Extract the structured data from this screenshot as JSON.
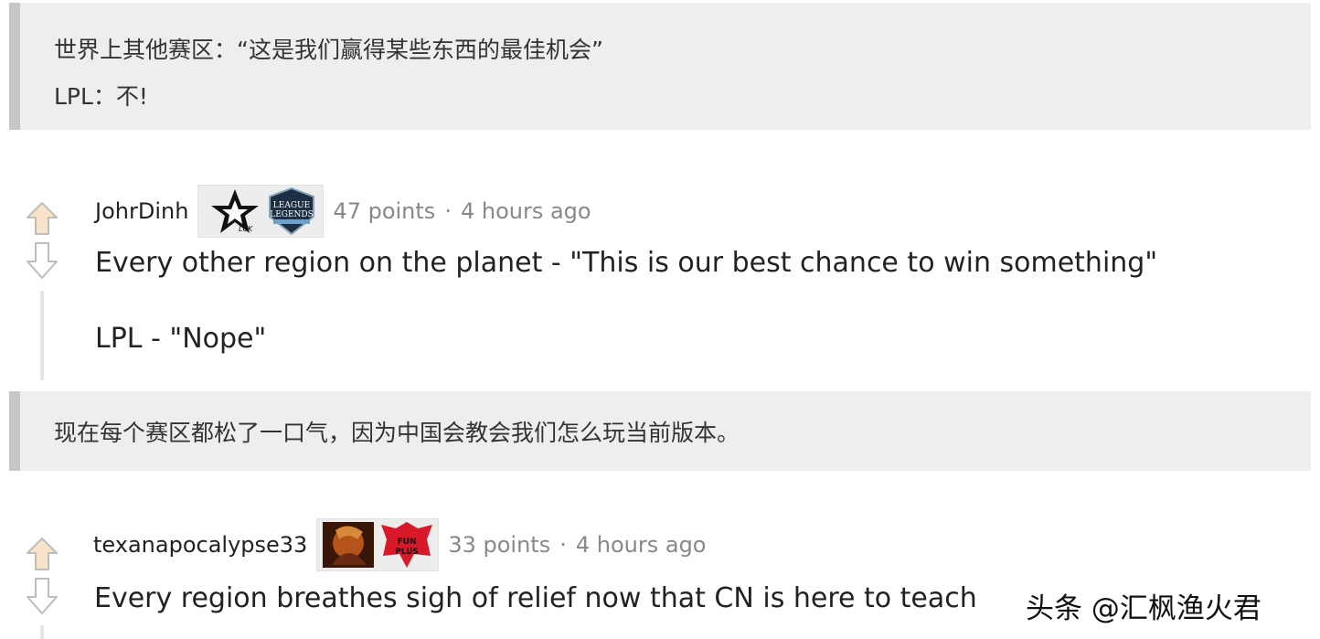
{
  "translation_1": {
    "line_1": "世界上其他赛区：“这是我们赢得某些东西的最佳机会”",
    "line_2": "LPL：不!"
  },
  "comment_1": {
    "username": "JohrDinh",
    "flair_icons": [
      "lck-star-logo-icon",
      "league-of-legends-championship-logo-icon"
    ],
    "points": "47 points",
    "separator": "·",
    "time": "4 hours ago",
    "paragraph_1": "Every other region on the planet - \"This is our best chance to win something\"",
    "paragraph_2": "LPL - \"Nope\""
  },
  "translation_2": {
    "line_1": "现在每个赛区都松了一口气，因为中国会教会我们怎么玩当前版本。"
  },
  "comment_2": {
    "username": "texanapocalypse33",
    "flair_icons": [
      "champion-portrait-icon",
      "funplus-phoenix-logo-icon"
    ],
    "points": "33 points",
    "separator": "·",
    "time": "4 hours ago",
    "paragraph_1": "Every region breathes sigh of relief now that CN is here to teach"
  },
  "watermark": "头条 @汇枫渔火君",
  "colors": {
    "quote_background": "#eeeeee",
    "quote_border": "#c6c6c6",
    "muted_text": "#888888",
    "vote_arrow": "#bdbdbd",
    "vote_arrow_up_fill": "#f7e3c8",
    "fpx_red": "#d7192a"
  }
}
